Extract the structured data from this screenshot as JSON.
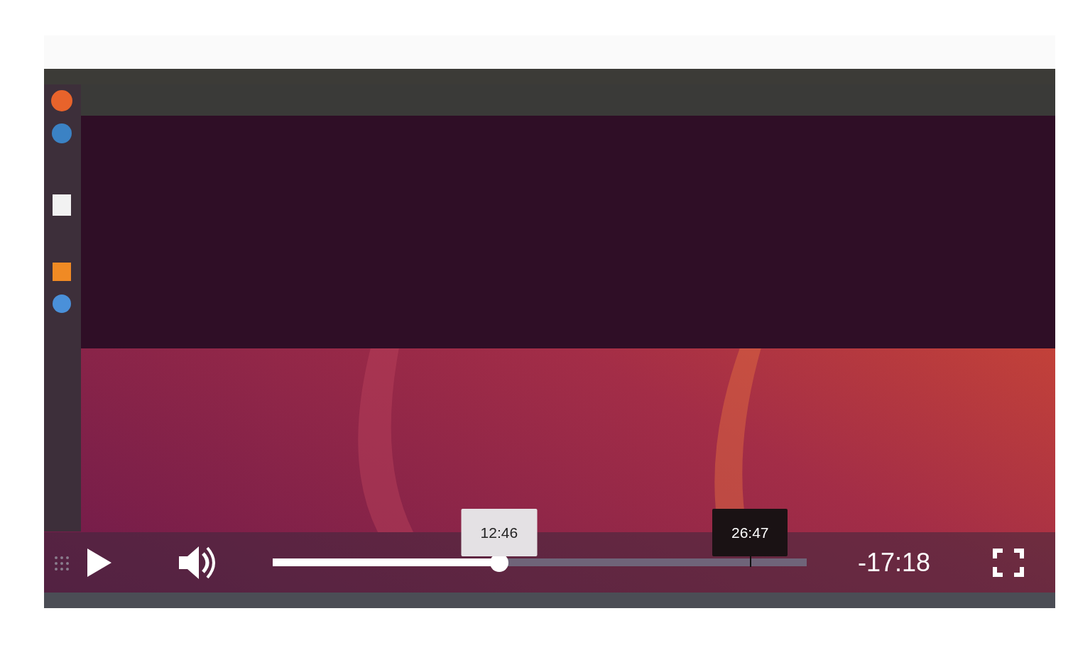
{
  "controls": {
    "playing": false,
    "muted": false,
    "seek": {
      "level": 0.424,
      "thumb_time": "12:46",
      "hover_time": "26:47"
    },
    "remaining": "-17:18"
  }
}
